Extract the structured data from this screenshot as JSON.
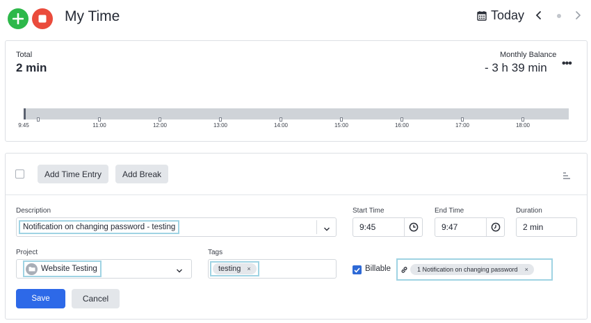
{
  "header": {
    "title": "My Time",
    "date_label": "Today"
  },
  "summary": {
    "total_label": "Total",
    "total_value": "2 min",
    "balance_label": "Monthly Balance",
    "balance_value": "- 3 h 39 min",
    "more": "•••"
  },
  "timeline": {
    "start_label": "9:45",
    "ticks": [
      "11:00",
      "12:00",
      "13:00",
      "14:00",
      "15:00",
      "16:00",
      "17:00",
      "18:00"
    ]
  },
  "toolbar": {
    "add_entry_label": "Add Time Entry",
    "add_break_label": "Add Break"
  },
  "entry": {
    "description_label": "Description",
    "description_value": "Notification on changing password - testing",
    "start_label": "Start Time",
    "start_value": "9:45",
    "end_label": "End Time",
    "end_value": "9:47",
    "duration_label": "Duration",
    "duration_value": "2 min",
    "project_label": "Project",
    "project_value": "Website Testing",
    "tags_label": "Tags",
    "tag_value": "testing",
    "tag_remove": "×",
    "billable_label": "Billable",
    "billable_checked": true,
    "link_value": "1 Notification on changing password",
    "link_remove": "×"
  },
  "actions": {
    "save_label": "Save",
    "cancel_label": "Cancel"
  },
  "colors": {
    "add_button": "#2db84a",
    "stop_button": "#ea4b3c",
    "primary": "#2d69e8",
    "highlight": "#9fd3e3"
  },
  "icons": [
    "plus-icon",
    "stop-icon",
    "calendar-icon",
    "chevron-left-icon",
    "chevron-right-icon",
    "more-icon",
    "sort-icon",
    "chevron-down-icon",
    "clock-icon",
    "folder-icon",
    "link-icon",
    "check-icon",
    "close-icon"
  ]
}
